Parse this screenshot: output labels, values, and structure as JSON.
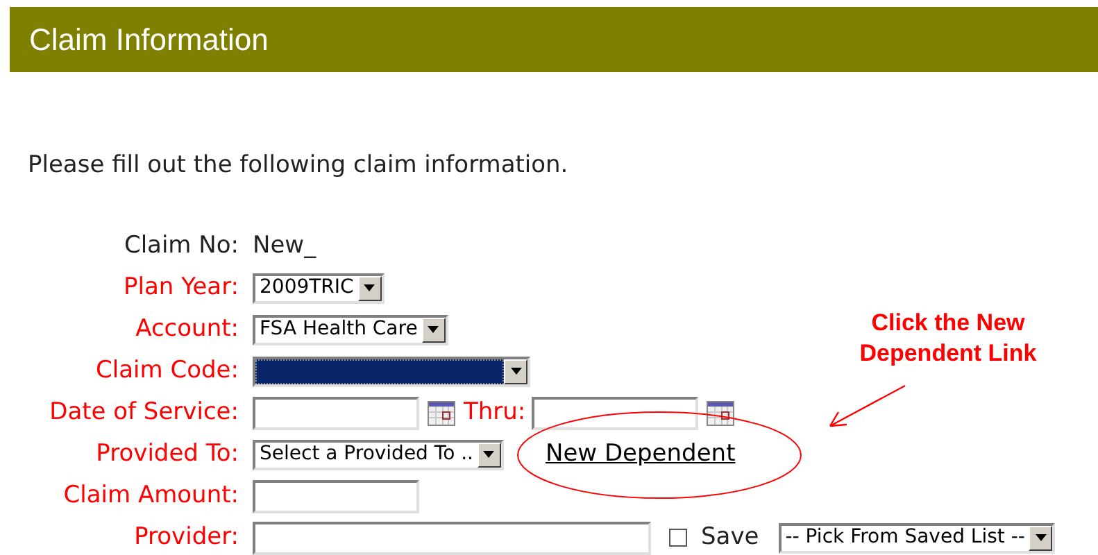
{
  "header": {
    "title": "Claim Information"
  },
  "intro": "Please fill out the following claim information.",
  "rows": [
    {
      "label": "Claim No:",
      "required": false,
      "controls": [
        {
          "kind": "text",
          "value": "New_"
        }
      ]
    },
    {
      "label": "Plan Year:",
      "required": true,
      "controls": [
        {
          "kind": "select",
          "value": "2009TRIC",
          "focused": false
        }
      ]
    },
    {
      "label": "Account:",
      "required": true,
      "controls": [
        {
          "kind": "select",
          "value": "FSA Health Care",
          "focused": false
        }
      ]
    },
    {
      "label": "Claim Code:",
      "required": true,
      "controls": [
        {
          "kind": "select",
          "focused": true
        }
      ]
    },
    {
      "label": "Date of Service:",
      "required": true,
      "controls": [
        {
          "kind": "date"
        },
        {
          "kind": "label",
          "text": "Thru:"
        },
        {
          "kind": "date"
        }
      ]
    },
    {
      "label": "Provided To:",
      "required": true,
      "controls": [
        {
          "kind": "select",
          "value": "Select a Provided To ..",
          "focused": false
        },
        {
          "kind": "link",
          "text": "New Dependent"
        }
      ]
    },
    {
      "label": "Claim Amount:",
      "required": true,
      "controls": [
        {
          "kind": "input"
        }
      ]
    },
    {
      "label": "Provider:",
      "required": true,
      "controls": [
        {
          "kind": "wide_input"
        },
        {
          "kind": "checkbox",
          "label": "Save",
          "checked": false
        },
        {
          "kind": "select",
          "value": "-- Pick From Saved List --",
          "focused": false
        }
      ]
    }
  ],
  "annotation": {
    "text": "Click the New Dependent Link"
  }
}
